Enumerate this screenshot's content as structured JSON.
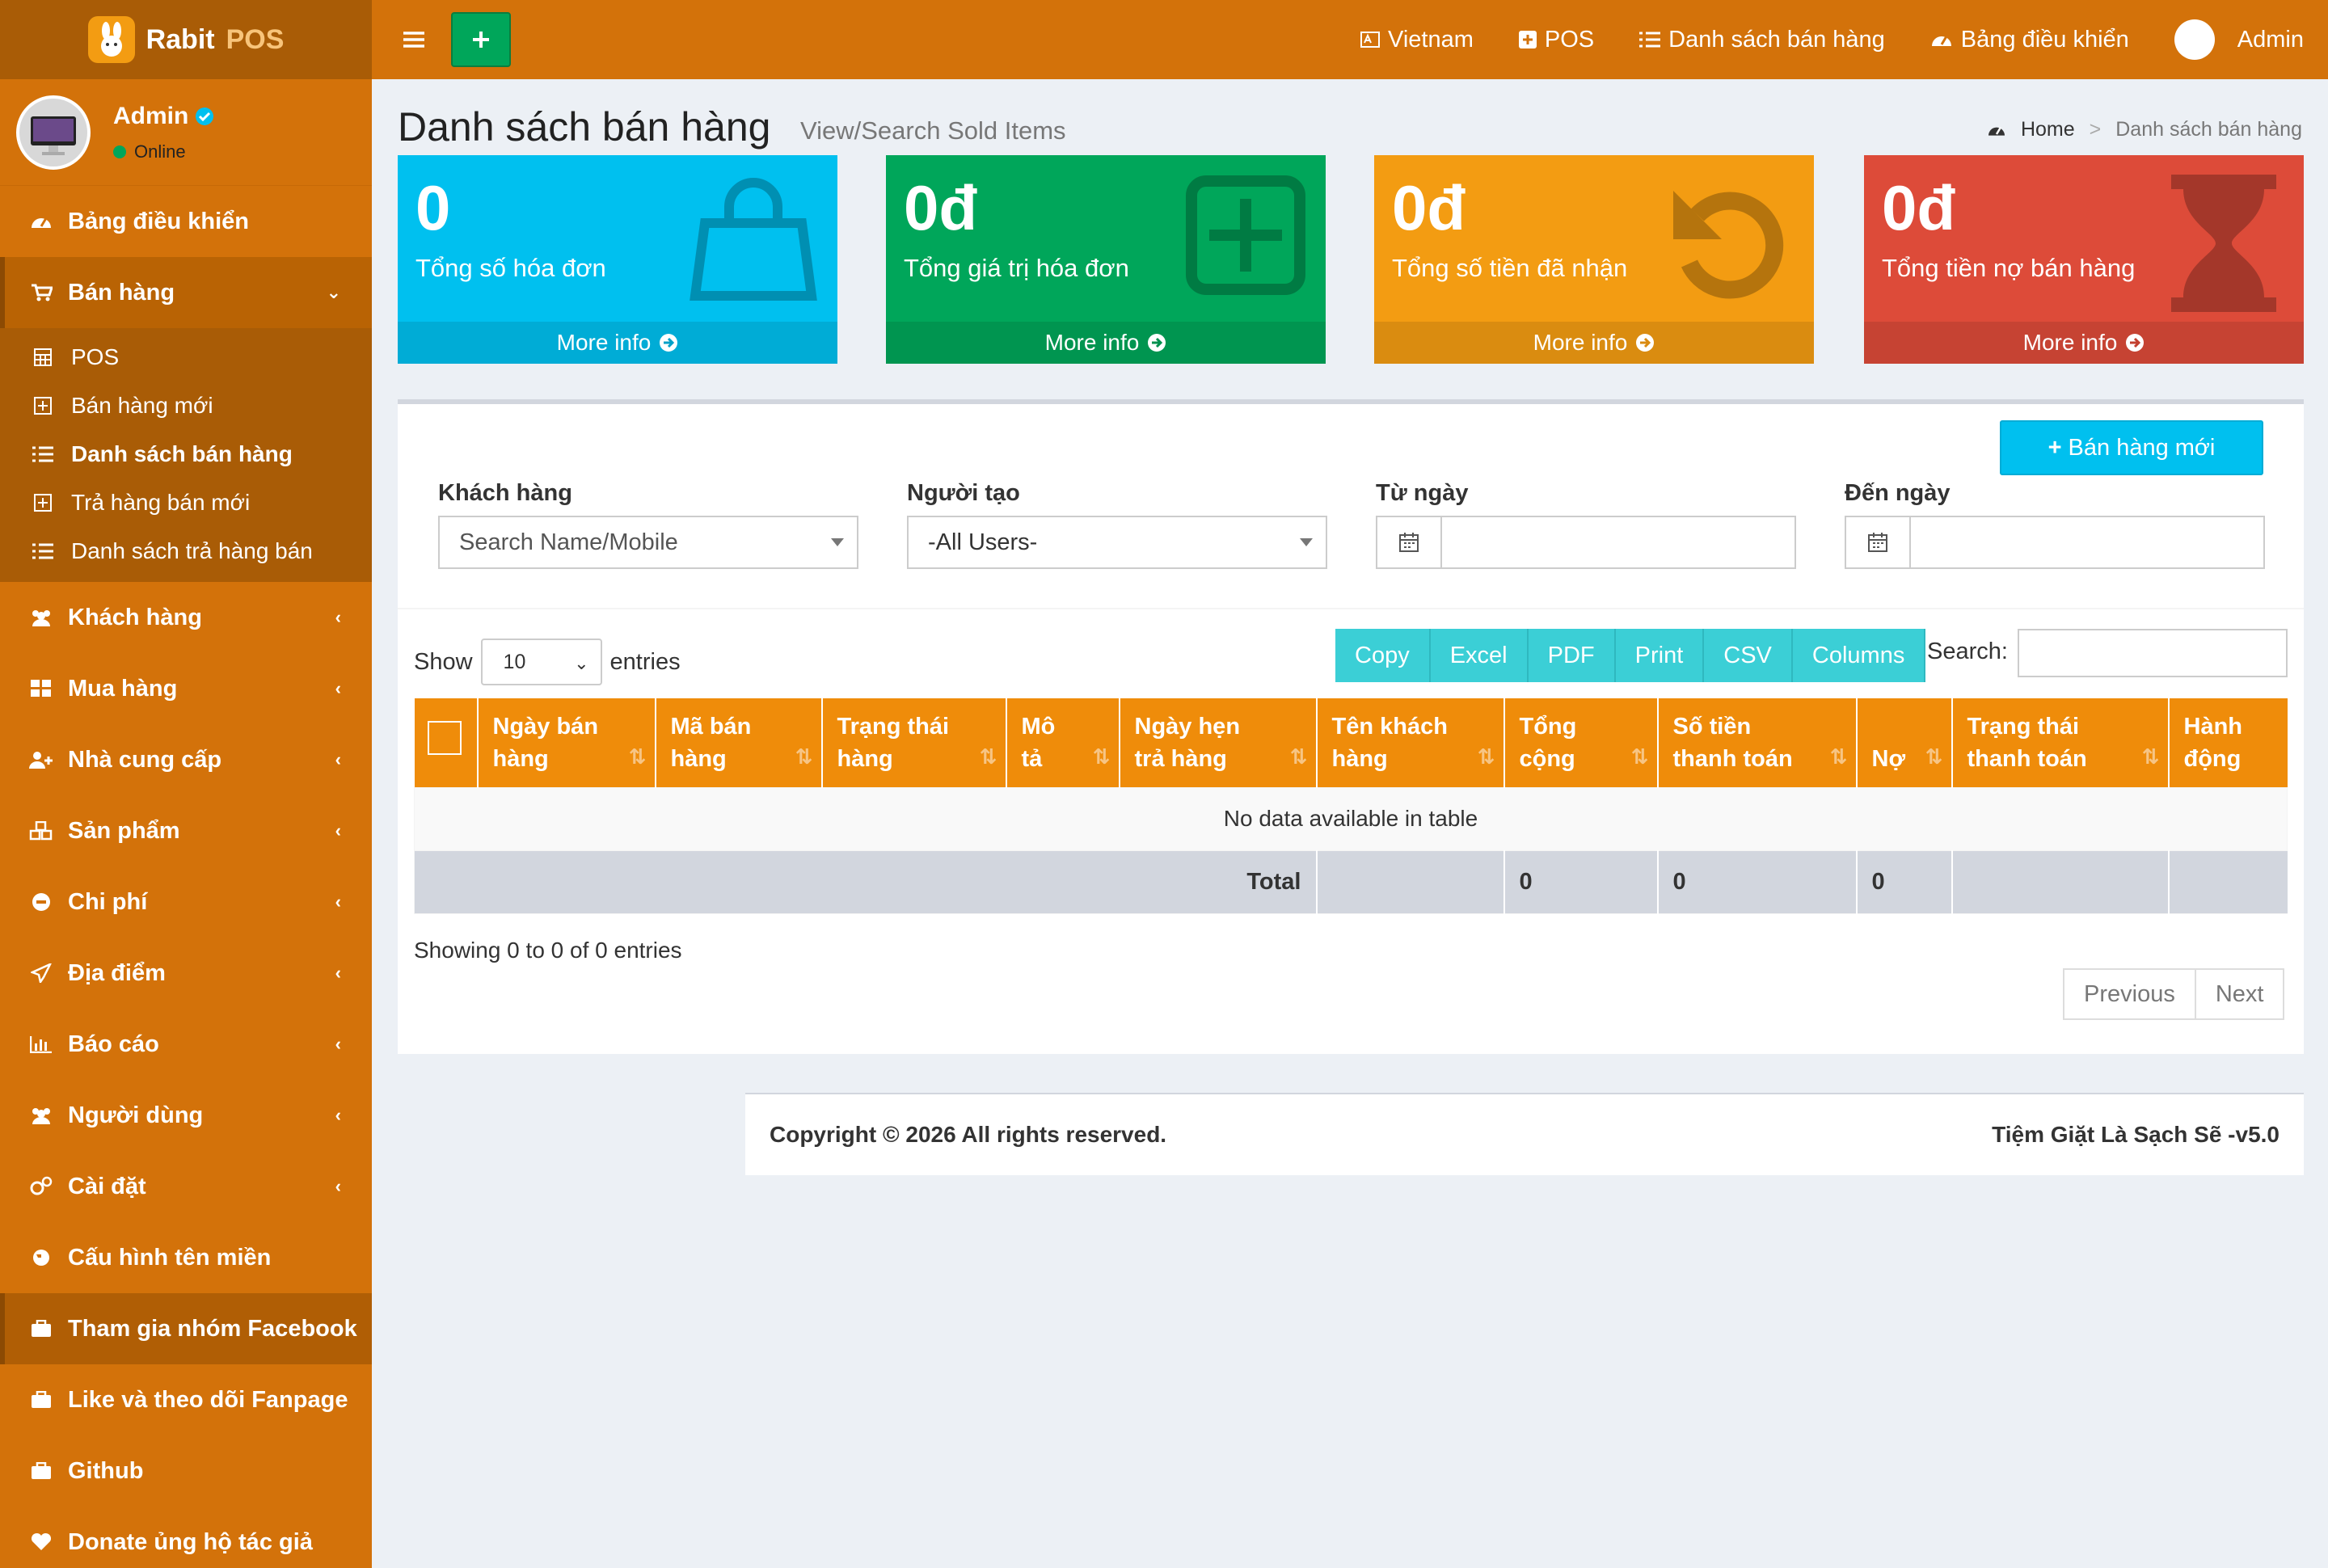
{
  "app": {
    "logo_main": "Rabit",
    "logo_accent": "POS"
  },
  "user": {
    "name": "Admin",
    "status": "Online"
  },
  "sidebar": {
    "dashboard": "Bảng điều khiển",
    "sales": "Bán hàng",
    "sales_sub": [
      "POS",
      "Bán hàng mới",
      "Danh sách bán hàng",
      "Trả hàng bán mới",
      "Danh sách trả hàng bán"
    ],
    "items": [
      "Khách hàng",
      "Mua hàng",
      "Nhà cung cấp",
      "Sản phẩm",
      "Chi phí",
      "Địa điểm",
      "Báo cáo",
      "Người dùng",
      "Cài đặt"
    ],
    "domain": "Cấu hình tên miền",
    "facebook_group": "Tham gia nhóm Facebook",
    "fanpage": "Like và theo dõi Fanpage",
    "github": "Github",
    "donate": "Donate ủng hộ tác giả"
  },
  "header": {
    "language": "Vietnam",
    "pos": "POS",
    "sales_list": "Danh sách bán hàng",
    "dashboard": "Bảng điều khiển",
    "admin": "Admin"
  },
  "page": {
    "title": "Danh sách bán hàng",
    "subtitle": "View/Search Sold Items",
    "breadcrumb_home": "Home",
    "breadcrumb_sep": ">",
    "breadcrumb_current": "Danh sách bán hàng"
  },
  "stats": [
    {
      "value": "0",
      "label": "Tổng số hóa đơn",
      "more": "More info",
      "color": "#00c0ef",
      "icon": "shopping-bag-icon"
    },
    {
      "value": "0đ",
      "label": "Tổng giá trị hóa đơn",
      "more": "More info",
      "color": "#00a65a",
      "icon": "plus-square-icon"
    },
    {
      "value": "0đ",
      "label": "Tổng số tiền đã nhận",
      "more": "More info",
      "color": "#f39c12",
      "icon": "undo-icon"
    },
    {
      "value": "0đ",
      "label": "Tổng tiền nợ bán hàng",
      "more": "More info",
      "color": "#dd4b39",
      "icon": "hourglass-icon"
    }
  ],
  "filters": {
    "new_sale_button": "Bán hàng mới",
    "customer_label": "Khách hàng",
    "customer_placeholder": "Search Name/Mobile",
    "creator_label": "Người tạo",
    "creator_value": "-All Users-",
    "from_label": "Từ ngày",
    "to_label": "Đến ngày"
  },
  "table": {
    "show_label": "Show",
    "entries_value": "10",
    "entries_label": "entries",
    "buttons": [
      "Copy",
      "Excel",
      "PDF",
      "Print",
      "CSV",
      "Columns"
    ],
    "search_label": "Search:",
    "headers": [
      [
        "Ngày bán",
        "hàng"
      ],
      [
        "Mã bán",
        "hàng"
      ],
      [
        "Trạng thái",
        "hàng"
      ],
      [
        "Mô",
        "tả"
      ],
      [
        "Ngày hẹn",
        "trả hàng"
      ],
      [
        "Tên khách",
        "hàng"
      ],
      [
        "Tổng",
        "cộng"
      ],
      [
        "Số tiền",
        "thanh toán"
      ],
      [
        "Nợ",
        ""
      ],
      [
        "Trạng thái",
        "thanh toán"
      ],
      [
        "Hành",
        "động"
      ]
    ],
    "empty": "No data available in table",
    "total_label": "Total",
    "total_sum": "0",
    "total_paid": "0",
    "total_debt": "0",
    "info": "Showing 0 to 0 of 0 entries",
    "prev": "Previous",
    "next": "Next"
  },
  "footer": {
    "copyright": "Copyright © 2026 All rights reserved.",
    "version": "Tiệm Giặt Là Sạch Sẽ -v5.0"
  },
  "colors": {
    "primary": "#d3720a",
    "sidebar_dark": "#a95c06",
    "table_header": "#ef8c0a",
    "button_teal": "#3bcfd6",
    "new_button": "#00c0ef"
  }
}
